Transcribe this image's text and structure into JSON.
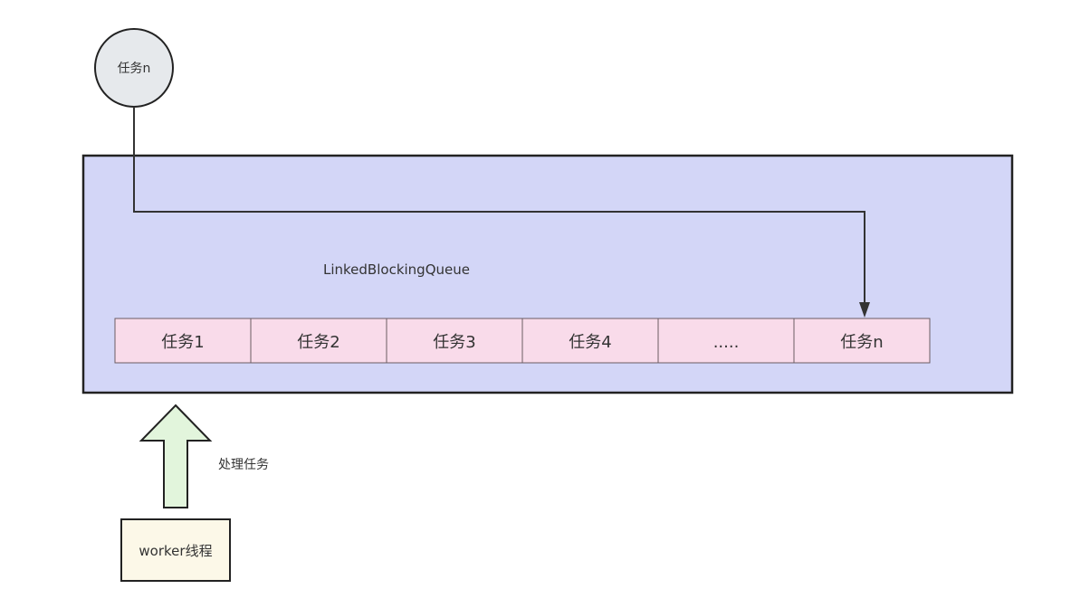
{
  "incoming_task": {
    "label": "任务n"
  },
  "queue": {
    "label": "LinkedBlockingQueue",
    "cells": [
      {
        "label": "任务1"
      },
      {
        "label": "任务2"
      },
      {
        "label": "任务3"
      },
      {
        "label": "任务4"
      },
      {
        "label": "....."
      },
      {
        "label": "任务n"
      }
    ]
  },
  "processing": {
    "label": "处理任务"
  },
  "worker": {
    "label": "worker线程"
  },
  "colors": {
    "queue_fill": "#d3d6f7",
    "cell_fill": "#f9dbea",
    "incoming_fill": "#e6e9ec",
    "arrow_fill": "#e2f5dc",
    "worker_fill": "#fcf8e8",
    "stroke": "#222222"
  }
}
